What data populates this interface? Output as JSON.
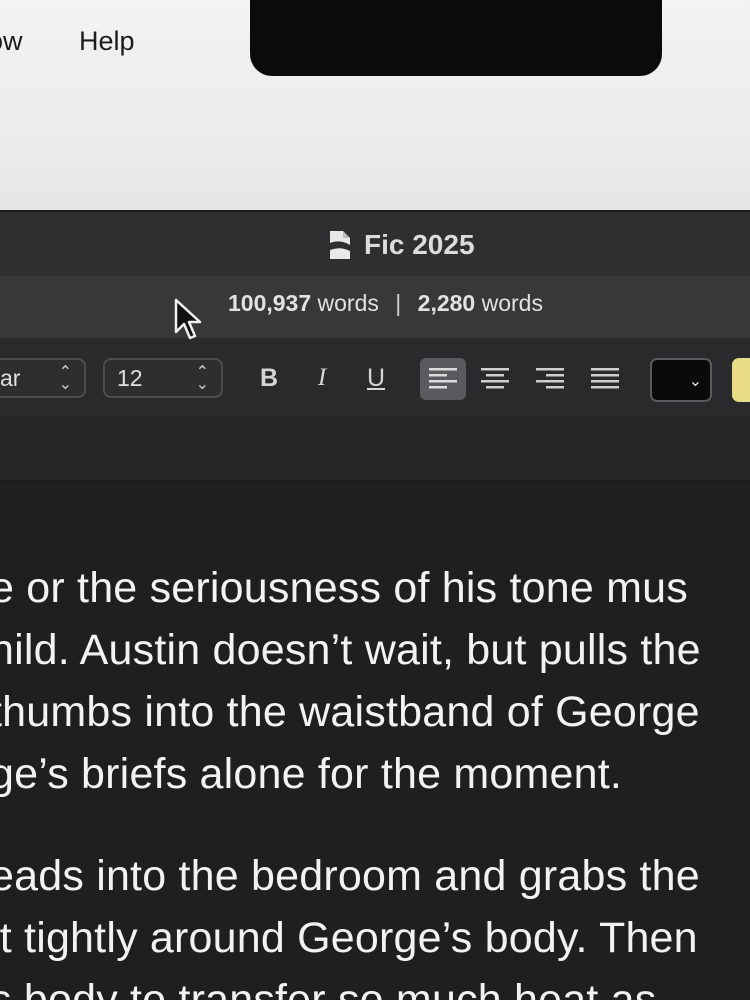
{
  "menubar": {
    "items": [
      {
        "label": "ow"
      },
      {
        "label": "Help"
      }
    ]
  },
  "window": {
    "title": "Fic 2025"
  },
  "wordcount": {
    "total": "100,937 words",
    "total_number": "100,937",
    "total_unit": "words",
    "separator": "|",
    "selection_number": "2,280",
    "selection_unit": "words"
  },
  "toolbar": {
    "font_value": "ar",
    "size_value": "12",
    "bold_label": "B",
    "italic_label": "I",
    "underline_label": "U",
    "alignment_active": "left",
    "text_color": "#0a0a0a",
    "highlight_color": "#e9dc86"
  },
  "document": {
    "paragraphs": [
      {
        "lines": [
          "e or the seriousness of his tone mus",
          "hild. Austin doesn’t wait, but pulls the",
          "thumbs into the waistband of George",
          "ge’s briefs alone for the moment."
        ]
      },
      {
        "lines": [
          "eads into the bedroom and grabs the",
          "it tightly around George’s body. Then",
          "s body to transfer so much heat as"
        ]
      }
    ]
  },
  "icons": {
    "document": "document-icon",
    "cursor": "arrow-cursor-icon",
    "stepper": "stepper-updown-icon",
    "chevron": "chevron-down-icon"
  }
}
